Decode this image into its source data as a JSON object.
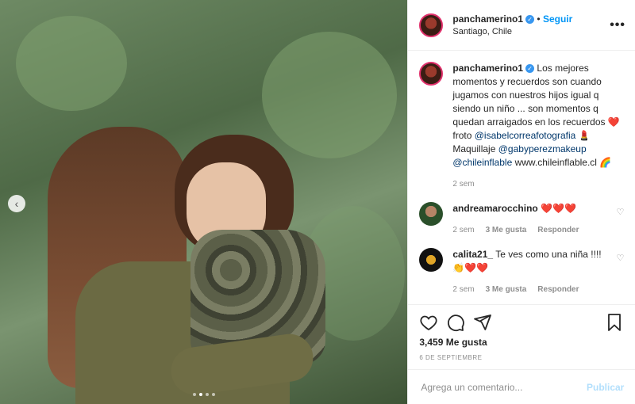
{
  "post": {
    "username": "panchamerino1",
    "verified": true,
    "follow_label": "Seguir",
    "location": "Santiago, Chile",
    "more_label": "•••"
  },
  "caption": {
    "username": "panchamerino1",
    "text_part1": "Los mejores momentos y recuerdos son cuando jugamos con nuestros hijos igual q siendo un niño ... son momentos q quedan arraigados en los recuerdos ",
    "heart": "❤️",
    "froto": " froto ",
    "mention1": "@isabelcorreafotografia",
    "lipstick": " 💄",
    "maquillaje": " Maquillaje ",
    "mention2": "@gabyperezmakeup",
    "mention3": "@chileinflable",
    "website": " www.chileinflable.cl ",
    "rainbow": "🌈",
    "time": "2 sem"
  },
  "comments": [
    {
      "username": "andreamarocchino",
      "text": "❤️❤️❤️",
      "time": "2 sem",
      "likes": "3 Me gusta",
      "reply_label": "Responder"
    },
    {
      "username": "calita21_",
      "text": "Te ves como una niña !!!! ",
      "emojis": "👏❤️❤️",
      "time": "2 sem",
      "likes": "3 Me gusta",
      "reply_label": "Responder"
    }
  ],
  "footer": {
    "likes": "3,459 Me gusta",
    "date": "6 DE SEPTIEMBRE",
    "comment_placeholder": "Agrega un comentario...",
    "publish_label": "Publicar"
  },
  "carousel": {
    "prev_icon": "‹",
    "slide_count": 4,
    "active_slide": 2
  },
  "colors": {
    "link": "#00376b",
    "follow": "#0095f6",
    "publish_disabled": "#b2dffc",
    "heart": "#ed4956"
  }
}
